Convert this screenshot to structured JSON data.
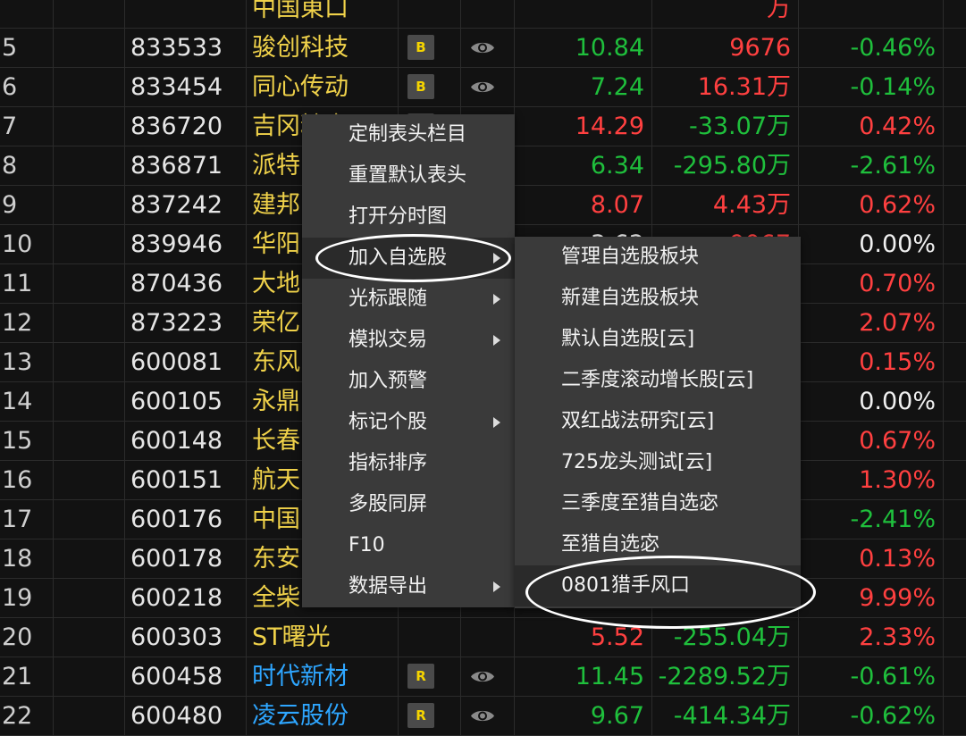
{
  "table": {
    "partial_top_row": {
      "name": "中国東口",
      "vol": "万"
    },
    "rows": [
      {
        "idx": "5",
        "code": "833533",
        "name": "骏创科技",
        "name_color": "yellow",
        "badge": "B",
        "price": "10.84",
        "price_color": "green",
        "vol": "9676",
        "vol_color": "red",
        "pct": "-0.46%",
        "pct_color": "green"
      },
      {
        "idx": "6",
        "code": "833454",
        "name": "同心传动",
        "name_color": "yellow",
        "badge": "B",
        "price": "7.24",
        "price_color": "green",
        "vol": "16.31万",
        "vol_color": "red",
        "pct": "-0.14%",
        "pct_color": "green"
      },
      {
        "idx": "7",
        "code": "836720",
        "name": "吉冈精密",
        "name_color": "yellow",
        "badge": "B",
        "price": "14.29",
        "price_color": "red",
        "vol": "-33.07万",
        "vol_color": "green",
        "pct": "0.42%",
        "pct_color": "red"
      },
      {
        "idx": "8",
        "code": "836871",
        "name": "派特",
        "name_color": "yellow",
        "badge": "",
        "price": "6.34",
        "price_color": "green",
        "vol": "-295.80万",
        "vol_color": "green",
        "pct": "-2.61%",
        "pct_color": "green"
      },
      {
        "idx": "9",
        "code": "837242",
        "name": "建邦",
        "name_color": "yellow",
        "badge": "",
        "price": "8.07",
        "price_color": "red",
        "vol": "4.43万",
        "vol_color": "red",
        "pct": "0.62%",
        "pct_color": "red"
      },
      {
        "idx": "10",
        "code": "839946",
        "name": "华阳",
        "name_color": "yellow",
        "badge": "",
        "price": "3.62",
        "price_color": "white",
        "vol": "9067",
        "vol_color": "red",
        "pct": "0.00%",
        "pct_color": "white"
      },
      {
        "idx": "11",
        "code": "870436",
        "name": "大地",
        "name_color": "yellow",
        "badge": "",
        "price": "",
        "price_color": "white",
        "vol": "",
        "vol_color": "white",
        "pct": "0.70%",
        "pct_color": "red"
      },
      {
        "idx": "12",
        "code": "873223",
        "name": "荣亿",
        "name_color": "yellow",
        "badge": "",
        "price": "",
        "price_color": "white",
        "vol": "",
        "vol_color": "white",
        "pct": "2.07%",
        "pct_color": "red"
      },
      {
        "idx": "13",
        "code": "600081",
        "name": "东风",
        "name_color": "yellow",
        "badge": "",
        "price": "",
        "price_color": "white",
        "vol": "",
        "vol_color": "white",
        "pct": "0.15%",
        "pct_color": "red"
      },
      {
        "idx": "14",
        "code": "600105",
        "name": "永鼎",
        "name_color": "yellow",
        "badge": "",
        "price": "",
        "price_color": "white",
        "vol": "",
        "vol_color": "white",
        "pct": "0.00%",
        "pct_color": "white"
      },
      {
        "idx": "15",
        "code": "600148",
        "name": "长春",
        "name_color": "yellow",
        "badge": "",
        "price": "",
        "price_color": "white",
        "vol": "",
        "vol_color": "white",
        "pct": "0.67%",
        "pct_color": "red"
      },
      {
        "idx": "16",
        "code": "600151",
        "name": "航天",
        "name_color": "yellow",
        "badge": "",
        "price": "",
        "price_color": "white",
        "vol": "",
        "vol_color": "white",
        "pct": "1.30%",
        "pct_color": "red"
      },
      {
        "idx": "17",
        "code": "600176",
        "name": "中国",
        "name_color": "yellow",
        "badge": "",
        "price": "",
        "price_color": "white",
        "vol": "",
        "vol_color": "white",
        "pct": "-2.41%",
        "pct_color": "green"
      },
      {
        "idx": "18",
        "code": "600178",
        "name": "东安",
        "name_color": "yellow",
        "badge": "",
        "price": "",
        "price_color": "white",
        "vol": "",
        "vol_color": "white",
        "pct": "0.13%",
        "pct_color": "red"
      },
      {
        "idx": "19",
        "code": "600218",
        "name": "全柴",
        "name_color": "yellow",
        "badge": "",
        "price": "",
        "price_color": "white",
        "vol": "",
        "vol_color": "white",
        "pct": "9.99%",
        "pct_color": "red"
      },
      {
        "idx": "20",
        "code": "600303",
        "name": "ST曙光",
        "name_color": "yellow",
        "badge": "",
        "price": "5.52",
        "price_color": "red",
        "vol": "-255.04万",
        "vol_color": "green",
        "pct": "2.33%",
        "pct_color": "red"
      },
      {
        "idx": "21",
        "code": "600458",
        "name": "时代新材",
        "name_color": "blue",
        "badge": "R",
        "price": "11.45",
        "price_color": "green",
        "vol": "-2289.52万",
        "vol_color": "green",
        "pct": "-0.61%",
        "pct_color": "green"
      },
      {
        "idx": "22",
        "code": "600480",
        "name": "凌云股份",
        "name_color": "blue",
        "badge": "R",
        "price": "9.67",
        "price_color": "green",
        "vol": "-414.34万",
        "vol_color": "green",
        "pct": "-0.62%",
        "pct_color": "green"
      }
    ]
  },
  "context_menu": {
    "items": [
      {
        "label": "定制表头栏目",
        "submenu": false
      },
      {
        "label": "重置默认表头",
        "submenu": false
      },
      {
        "label": "打开分时图",
        "submenu": false
      },
      {
        "label": "加入自选股",
        "submenu": true,
        "highlighted": true
      },
      {
        "label": "光标跟随",
        "submenu": true
      },
      {
        "label": "模拟交易",
        "submenu": true
      },
      {
        "label": "加入预警",
        "submenu": false
      },
      {
        "label": "标记个股",
        "submenu": true
      },
      {
        "label": "指标排序",
        "submenu": false
      },
      {
        "label": "多股同屏",
        "submenu": false
      },
      {
        "label": "F10",
        "submenu": false
      },
      {
        "label": "数据导出",
        "submenu": true
      }
    ]
  },
  "submenu": {
    "items": [
      {
        "label": "管理自选股板块"
      },
      {
        "label": "新建自选股板块"
      },
      {
        "label": "默认自选股[云]"
      },
      {
        "label": "二季度滚动增长股[云]"
      },
      {
        "label": "双红战法研究[云]"
      },
      {
        "label": "725龙头测试[云]"
      },
      {
        "label": "三季度至猎自选宓"
      },
      {
        "label": "至猎自选宓"
      },
      {
        "label": "0801猎手风口",
        "highlighted": true
      }
    ]
  },
  "colors": {
    "yellow": "#f0d24a",
    "blue": "#2ea6ff",
    "green": "#1fbf3c",
    "red": "#ff4040",
    "white": "#f0f0f0"
  }
}
